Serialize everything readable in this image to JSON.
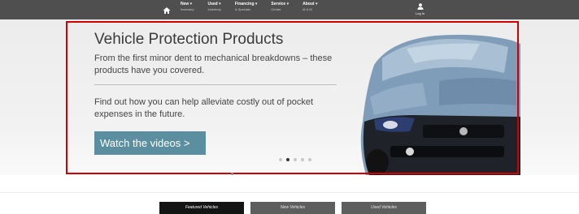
{
  "nav": {
    "items": [
      {
        "main": "New ▾",
        "sub": "Inventory"
      },
      {
        "main": "Used ▾",
        "sub": "Inventory"
      },
      {
        "main": "Financing ▾",
        "sub": "& Specials"
      },
      {
        "main": "Service ▾",
        "sub": "Center"
      },
      {
        "main": "About ▾",
        "sub": "M & M"
      }
    ],
    "login_label": "Log In"
  },
  "hero": {
    "title": "Vehicle Protection Products",
    "subtitle": "From the first minor dent to mechanical breakdowns – these products have you covered.",
    "body": "Find out how you can help alleviate costly out of pocket expenses in the future.",
    "button_label": "Watch the videos >",
    "slide_count": 5,
    "active_slide": 2
  },
  "tabs": [
    {
      "label": "Featured Vehicles",
      "active": true
    },
    {
      "label": "New Vehicles",
      "active": false
    },
    {
      "label": "Used Vehicles",
      "active": false
    }
  ],
  "colors": {
    "nav_bg": "#4f4f4f",
    "button_bg": "#5b8fa0",
    "highlight_border": "#d10000",
    "tab_active": "#141414",
    "tab_inactive": "#5e5e5e"
  }
}
